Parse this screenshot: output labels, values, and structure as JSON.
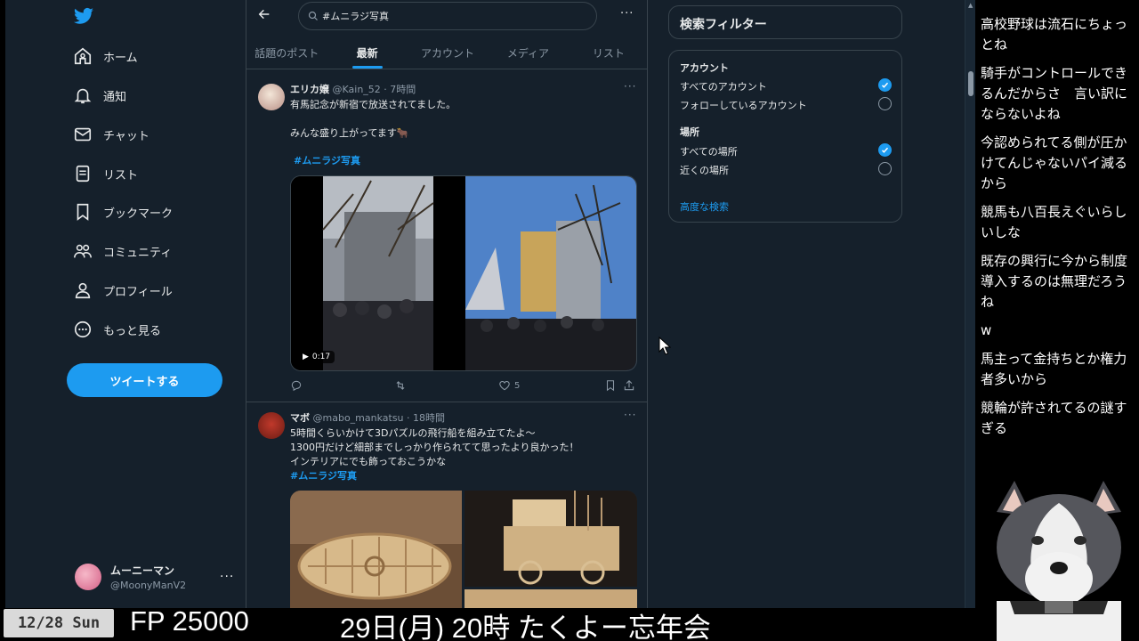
{
  "nav": {
    "items": [
      {
        "label": "ホーム",
        "icon": "home-icon"
      },
      {
        "label": "通知",
        "icon": "bell-icon"
      },
      {
        "label": "チャット",
        "icon": "mail-icon"
      },
      {
        "label": "リスト",
        "icon": "list-icon"
      },
      {
        "label": "ブックマーク",
        "icon": "bookmark-icon"
      },
      {
        "label": "コミュニティ",
        "icon": "community-icon"
      },
      {
        "label": "プロフィール",
        "icon": "person-icon"
      },
      {
        "label": "もっと見る",
        "icon": "more-circle-icon"
      }
    ],
    "tweet_button": "ツイートする",
    "account": {
      "name": "ムーニーマン",
      "handle": "@MoonyManV2",
      "more": "···"
    }
  },
  "search": {
    "query": "#ムニラジ写真",
    "more": "···"
  },
  "tabs": [
    {
      "label": "話題のポスト",
      "active": false
    },
    {
      "label": "最新",
      "active": true
    },
    {
      "label": "アカウント",
      "active": false
    },
    {
      "label": "メディア",
      "active": false
    },
    {
      "label": "リスト",
      "active": false
    }
  ],
  "posts": [
    {
      "name": "エリカ嬢",
      "handle": "@Kain_52 · 7時間",
      "line1": "有馬記念が新宿で放送されてました。",
      "line2": "みんな盛り上がってます🐂",
      "hashtag": "#ムニラジ写真",
      "video_duration": "0:17",
      "likes": "5",
      "more": "···"
    },
    {
      "name": "マボ",
      "handle": "@mabo_mankatsu · 18時間",
      "line1": "5時間くらいかけて3Dパズルの飛行船を組み立てたよ〜",
      "line2": "1300円だけど細部までしっかり作られてて思ったより良かった！",
      "line3": "インテリアにでも飾っておこうかな",
      "hashtag": "#ムニラジ写真",
      "more": "···"
    }
  ],
  "filters": {
    "title": "検索フィルター",
    "account_section": "アカウント",
    "account_options": [
      {
        "label": "すべてのアカウント",
        "selected": true
      },
      {
        "label": "フォローしているアカウント",
        "selected": false
      }
    ],
    "place_section": "場所",
    "place_options": [
      {
        "label": "すべての場所",
        "selected": true
      },
      {
        "label": "近くの場所",
        "selected": false
      }
    ],
    "advanced_link": "高度な検索"
  },
  "chat": [
    "高校野球は流石にちょっとね",
    "騎手がコントロールできるんだからさ　言い訳にならないよね",
    "今認められてる側が圧かけてんじゃないパイ減るから",
    "競馬も八百長えぐいらしいしな",
    "既存の興行に今から制度導入するのは無理だろうね",
    "w",
    "馬主って金持ちとか権力者多いから",
    "競輪が許されてるの謎すぎる"
  ],
  "ticker": {
    "date": "12/28 Sun",
    "fp": "FP 25000",
    "event": "29日(月) 20時 たくよー忘年会"
  },
  "colors": {
    "background": "#15202b",
    "accent": "#1d9bf0",
    "border": "#38444d",
    "muted": "#8b98a5"
  }
}
